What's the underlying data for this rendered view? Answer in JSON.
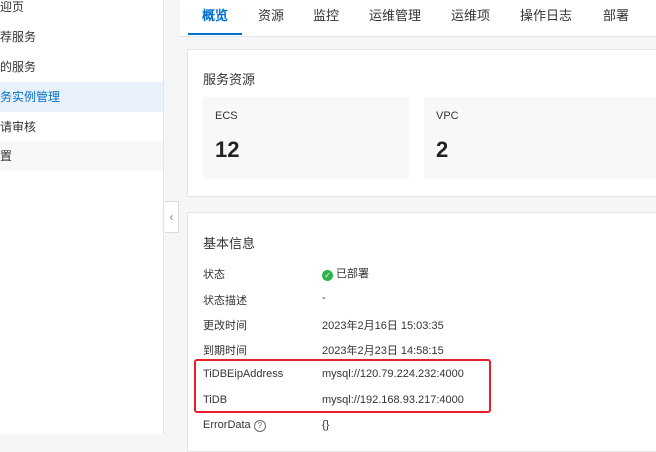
{
  "sidebar": {
    "items": [
      {
        "label": "欢迎页"
      },
      {
        "label": "推荐服务"
      },
      {
        "label": "我的服务"
      },
      {
        "label": "服务实例管理"
      },
      {
        "label": "申请审核"
      },
      {
        "label": "设置"
      }
    ]
  },
  "tabs": [
    {
      "label": "概览"
    },
    {
      "label": "资源"
    },
    {
      "label": "监控"
    },
    {
      "label": "运维管理"
    },
    {
      "label": "运维项"
    },
    {
      "label": "操作日志"
    },
    {
      "label": "部署"
    }
  ],
  "service_resources": {
    "title": "服务资源",
    "items": [
      {
        "label": "ECS",
        "value": "12"
      },
      {
        "label": "VPC",
        "value": "2"
      }
    ]
  },
  "basic_info": {
    "title": "基本信息",
    "rows": [
      {
        "label": "状态",
        "value": "已部署"
      },
      {
        "label": "状态描述",
        "value": "-"
      },
      {
        "label": "更改时间",
        "value": "2023年2月16日 15:03:35"
      },
      {
        "label": "到期时间",
        "value": "2023年2月23日 14:58:15"
      },
      {
        "label": "TiDBEipAddress",
        "value": "mysql://120.79.224.232:4000"
      },
      {
        "label": "TiDB",
        "value": "mysql://192.168.93.217:4000"
      },
      {
        "label": "ErrorData",
        "value": "{}"
      }
    ]
  },
  "icons": {
    "collapse": "chevron-left-icon",
    "status": "check-circle-icon",
    "help": "question-circle-icon"
  },
  "colors": {
    "accent": "#0070cc",
    "success": "#2fb44a",
    "highlight": "#e8202a"
  }
}
